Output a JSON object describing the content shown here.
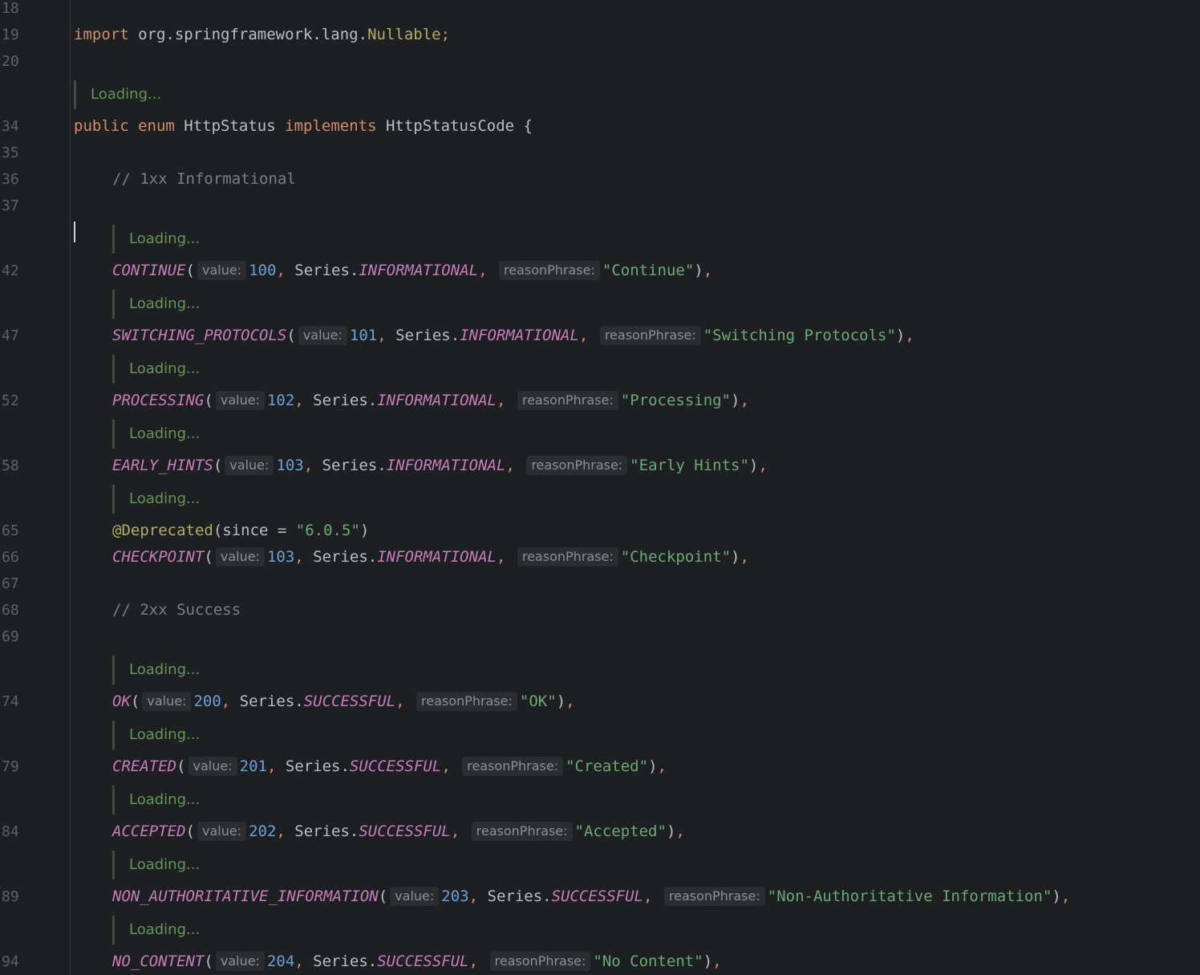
{
  "editor": {
    "loading_text": "Loading...",
    "lines": [
      {
        "ln": "18"
      },
      {
        "ln": "19",
        "tokens": [
          {
            "t": "import",
            "c": "kw"
          },
          {
            "t": " org.springframework.lang."
          },
          {
            "t": "Nullable",
            "c": "ann"
          },
          {
            "t": ";",
            "c": "kw"
          }
        ]
      },
      {
        "ln": "20"
      },
      {
        "ln": "34",
        "tokens": [
          {
            "t": "public",
            "c": "kw"
          },
          {
            "t": " "
          },
          {
            "t": "enum",
            "c": "kw"
          },
          {
            "t": " HttpStatus "
          },
          {
            "t": "implements",
            "c": "kw"
          },
          {
            "t": " HttpStatusCode {"
          }
        ]
      },
      {
        "ln": "35"
      },
      {
        "ln": "36",
        "indent": 1,
        "tokens": [
          {
            "t": "// 1xx Informational",
            "c": "cmt"
          }
        ]
      },
      {
        "ln": "37"
      },
      {
        "ln": "42",
        "indent": 1,
        "status": {
          "name": "CONTINUE",
          "value": "100",
          "series": "INFORMATIONAL",
          "phrase": "\"Continue\""
        }
      },
      {
        "ln": "47",
        "indent": 1,
        "status": {
          "name": "SWITCHING_PROTOCOLS",
          "value": "101",
          "series": "INFORMATIONAL",
          "phrase": "\"Switching Protocols\""
        }
      },
      {
        "ln": "52",
        "indent": 1,
        "status": {
          "name": "PROCESSING",
          "value": "102",
          "series": "INFORMATIONAL",
          "phrase": "\"Processing\""
        }
      },
      {
        "ln": "58",
        "indent": 1,
        "status": {
          "name": "EARLY_HINTS",
          "value": "103",
          "series": "INFORMATIONAL",
          "phrase": "\"Early Hints\""
        }
      },
      {
        "ln": "65",
        "indent": 1,
        "tokens": [
          {
            "t": "@Deprecated",
            "c": "ann"
          },
          {
            "t": "(since = "
          },
          {
            "t": "\"6.0.5\"",
            "c": "str"
          },
          {
            "t": ")"
          }
        ]
      },
      {
        "ln": "66",
        "indent": 1,
        "status": {
          "name": "CHECKPOINT",
          "value": "103",
          "series": "INFORMATIONAL",
          "phrase": "\"Checkpoint\""
        }
      },
      {
        "ln": "67"
      },
      {
        "ln": "68",
        "indent": 1,
        "tokens": [
          {
            "t": "// 2xx Success",
            "c": "cmt"
          }
        ]
      },
      {
        "ln": "69"
      },
      {
        "ln": "74",
        "indent": 1,
        "status": {
          "name": "OK",
          "value": "200",
          "series": "SUCCESSFUL",
          "phrase": "\"OK\""
        }
      },
      {
        "ln": "79",
        "indent": 1,
        "status": {
          "name": "CREATED",
          "value": "201",
          "series": "SUCCESSFUL",
          "phrase": "\"Created\""
        }
      },
      {
        "ln": "84",
        "indent": 1,
        "status": {
          "name": "ACCEPTED",
          "value": "202",
          "series": "SUCCESSFUL",
          "phrase": "\"Accepted\""
        }
      },
      {
        "ln": "89",
        "indent": 1,
        "status": {
          "name": "NON_AUTHORITATIVE_INFORMATION",
          "value": "203",
          "series": "SUCCESSFUL",
          "phrase": "\"Non-Authoritative Information\""
        }
      },
      {
        "ln": "94",
        "indent": 1,
        "status": {
          "name": "NO_CONTENT",
          "value": "204",
          "series": "SUCCESSFUL",
          "phrase": "\"No Content\""
        }
      }
    ],
    "hints": {
      "value_label": "value:",
      "phrase_label": "reasonPhrase:",
      "series_prefix": "Series."
    }
  }
}
